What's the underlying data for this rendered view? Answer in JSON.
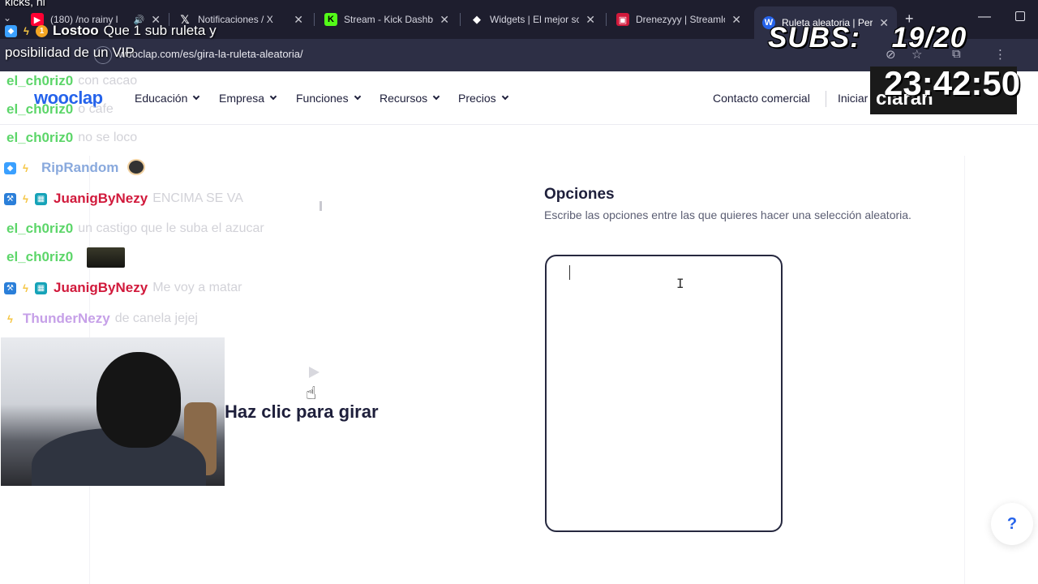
{
  "browser": {
    "tabs": [
      {
        "title": "(180) /no rainy l",
        "favicon": "youtube-icon",
        "color": "#ff0033"
      },
      {
        "title": "Notificaciones / X",
        "favicon": "x-icon",
        "color": "#ffffff"
      },
      {
        "title": "Stream - Kick Dashbo",
        "favicon": "kick-icon",
        "color": "#53fc18"
      },
      {
        "title": "Widgets | El mejor sc",
        "favicon": "widgets-icon",
        "color": "#ffffff"
      },
      {
        "title": "Drenezyyy | Streamlo",
        "favicon": "streamlabs-icon",
        "color": "#d1193b"
      },
      {
        "title": "Ruleta aleatoria | Per",
        "favicon": "wooclap-icon",
        "color": "#2563eb",
        "active": true
      }
    ],
    "url": "wooclap.com/es/gira-la-ruleta-aleatoria/"
  },
  "site": {
    "logo": "wooclap",
    "nav": [
      "Educación",
      "Empresa",
      "Funciones",
      "Recursos",
      "Precios"
    ],
    "contact": "Contacto comercial",
    "login": "Iniciar"
  },
  "main": {
    "options_title": "Opciones",
    "options_desc": "Escribe las opciones entre las que quieres hacer una selección aleatoria.",
    "options_value": "",
    "spin_label": "Haz clic para girar",
    "help": "?"
  },
  "overlay": {
    "top_chat": "kicks, ni",
    "pinned": {
      "user": "Lostoo",
      "text": "Que 1 sub ruleta y",
      "text2": "posibilidad de un VIP"
    },
    "chat": [
      {
        "user": "el_ch0riz0",
        "msg": "con cacao",
        "color": "green"
      },
      {
        "user": "el_ch0riz0",
        "msg": "o cafe",
        "color": "green"
      },
      {
        "user": "el_ch0riz0",
        "msg": "no se loco",
        "color": "green"
      },
      {
        "user": "RipRandom",
        "msg": "",
        "color": "blue"
      },
      {
        "user": "JuanigByNezy",
        "msg": "ENCIMA SE VA",
        "color": "red"
      },
      {
        "user": "el_ch0riz0",
        "msg": "un castigo que le suba el azucar",
        "color": "green"
      },
      {
        "user": "el_ch0riz0",
        "msg": "",
        "color": "green"
      },
      {
        "user": "JuanigByNezy",
        "msg": "Me voy a matar",
        "color": "red"
      },
      {
        "user": "ThunderNezy",
        "msg": "de canela jejej",
        "color": "purple"
      }
    ],
    "subs_label": "SUBS:",
    "subs_count": "19/20",
    "timer": "23:42:50",
    "timer_under": "ciaran"
  }
}
